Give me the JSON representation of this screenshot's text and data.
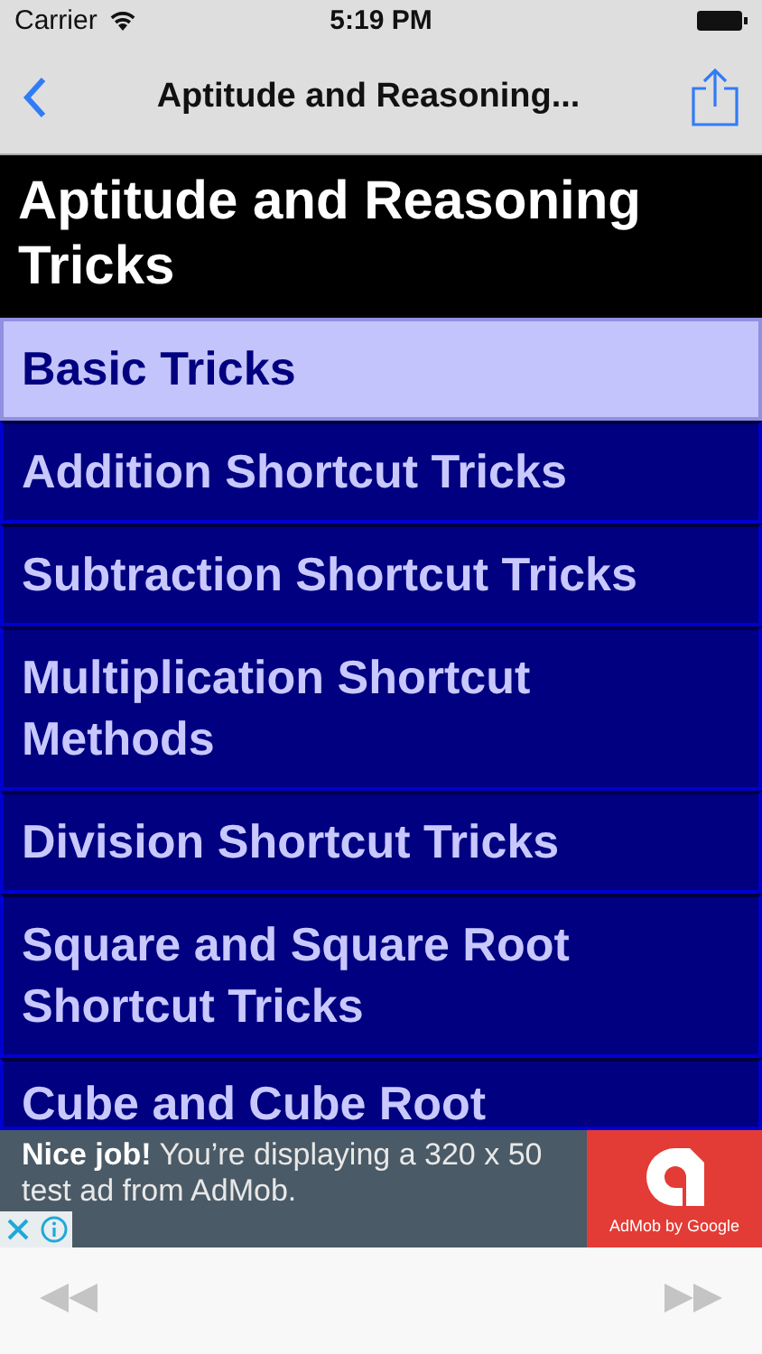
{
  "status_bar": {
    "carrier": "Carrier",
    "time": "5:19 PM"
  },
  "nav_bar": {
    "title": "Aptitude and Reasoning..."
  },
  "heading": "Aptitude and Reasoning Tricks",
  "items": [
    {
      "label": "Basic Tricks",
      "selected": true
    },
    {
      "label": "Addition Shortcut Tricks",
      "selected": false
    },
    {
      "label": "Subtraction Shortcut Tricks",
      "selected": false
    },
    {
      "label": "Multiplication Shortcut Methods",
      "selected": false
    },
    {
      "label": "Division Shortcut Tricks",
      "selected": false
    },
    {
      "label": "Square and Square Root Shortcut Tricks",
      "selected": false
    },
    {
      "label": "Cube and Cube Root",
      "selected": false
    }
  ],
  "ad": {
    "text": "**Nice job!** You’re displaying a 320 x 50 test ad from AdMob.",
    "brand": "AdMob by Google"
  }
}
